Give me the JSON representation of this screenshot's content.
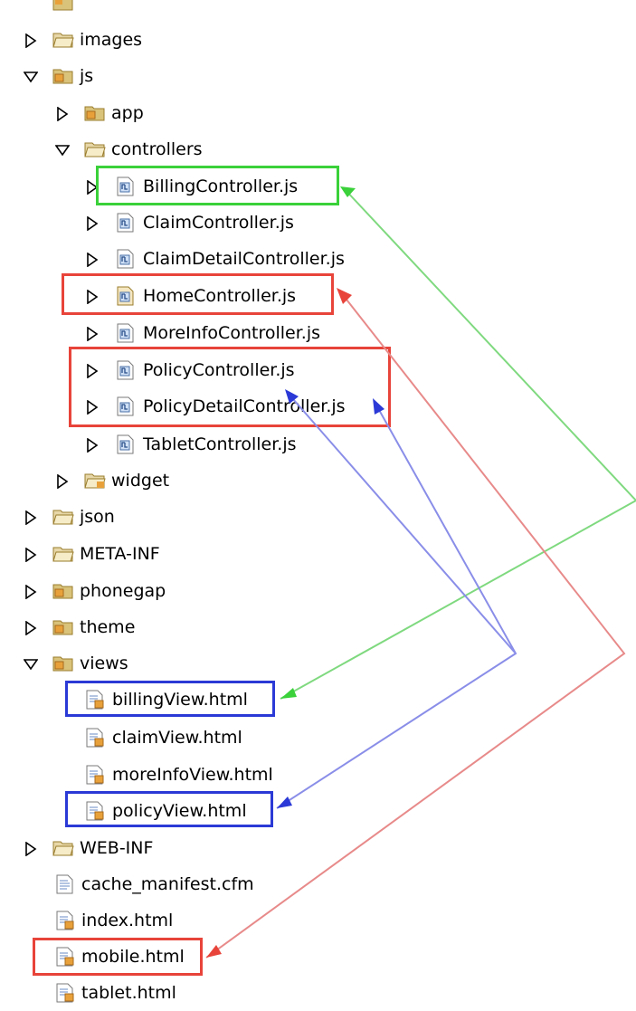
{
  "tree": {
    "items": [
      {
        "label": "",
        "icon": "package-folder-icon",
        "twisty": "none",
        "level": 1
      },
      {
        "label": "images",
        "icon": "folder-icon",
        "twisty": "collapsed",
        "level": 1
      },
      {
        "label": "js",
        "icon": "package-folder-icon",
        "twisty": "expanded",
        "level": 1
      },
      {
        "label": "app",
        "icon": "package-folder-icon",
        "twisty": "collapsed",
        "level": 2
      },
      {
        "label": "controllers",
        "icon": "folder-icon",
        "twisty": "expanded",
        "level": 2
      },
      {
        "label": "BillingController.js",
        "icon": "js-file-icon",
        "twisty": "collapsed",
        "level": 3
      },
      {
        "label": "ClaimController.js",
        "icon": "js-file-icon",
        "twisty": "collapsed",
        "level": 3
      },
      {
        "label": "ClaimDetailController.js",
        "icon": "js-file-icon",
        "twisty": "collapsed",
        "level": 3
      },
      {
        "label": "HomeController.js",
        "icon": "js-file-icon",
        "twisty": "collapsed",
        "level": 3
      },
      {
        "label": "MoreInfoController.js",
        "icon": "js-file-icon",
        "twisty": "collapsed",
        "level": 3
      },
      {
        "label": "PolicyController.js",
        "icon": "js-file-icon",
        "twisty": "collapsed",
        "level": 3
      },
      {
        "label": "PolicyDetailController.js",
        "icon": "js-file-icon",
        "twisty": "collapsed",
        "level": 3
      },
      {
        "label": "TabletController.js",
        "icon": "js-file-icon",
        "twisty": "collapsed",
        "level": 3
      },
      {
        "label": "widget",
        "icon": "folder-icon",
        "twisty": "collapsed",
        "level": 2
      },
      {
        "label": "json",
        "icon": "folder-icon",
        "twisty": "collapsed",
        "level": 1
      },
      {
        "label": "META-INF",
        "icon": "folder-icon",
        "twisty": "collapsed",
        "level": 1
      },
      {
        "label": "phonegap",
        "icon": "package-folder-icon",
        "twisty": "collapsed",
        "level": 1
      },
      {
        "label": "theme",
        "icon": "package-folder-icon",
        "twisty": "collapsed",
        "level": 1
      },
      {
        "label": "views",
        "icon": "package-folder-icon",
        "twisty": "expanded",
        "level": 1
      },
      {
        "label": "billingView.html",
        "icon": "html-file-icon",
        "twisty": "none",
        "level": 2
      },
      {
        "label": "claimView.html",
        "icon": "html-file-icon",
        "twisty": "none",
        "level": 2
      },
      {
        "label": "moreInfoView.html",
        "icon": "html-file-icon",
        "twisty": "none",
        "level": 2
      },
      {
        "label": "policyView.html",
        "icon": "html-file-icon",
        "twisty": "none",
        "level": 2
      },
      {
        "label": "WEB-INF",
        "icon": "folder-icon",
        "twisty": "collapsed",
        "level": 1
      },
      {
        "label": "cache_manifest.cfm",
        "icon": "text-file-icon",
        "twisty": "none",
        "level": 1
      },
      {
        "label": "index.html",
        "icon": "html-file-icon",
        "twisty": "none",
        "level": 1
      },
      {
        "label": "mobile.html",
        "icon": "html-file-icon",
        "twisty": "none",
        "level": 1
      },
      {
        "label": "tablet.html",
        "icon": "html-file-icon",
        "twisty": "none",
        "level": 1
      }
    ]
  },
  "annotations": {
    "colors": {
      "green": "#3ad13a",
      "red": "#e8443a",
      "blue": "#2b3ad6",
      "green_arrow": "#7fd97f",
      "red_arrow": "#e88a8a",
      "blue_arrow": "#8a8ee8"
    }
  }
}
